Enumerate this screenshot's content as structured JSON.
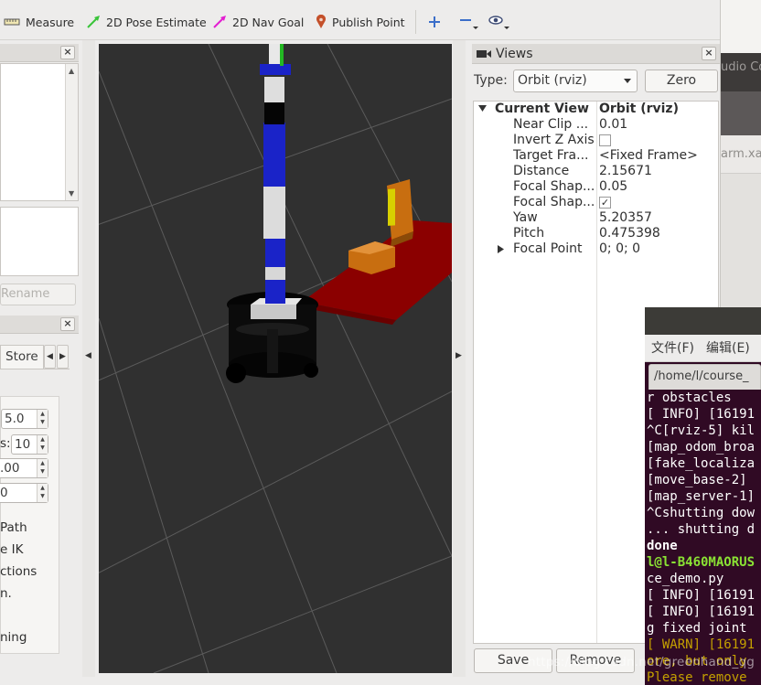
{
  "toolbar": {
    "tools": [
      {
        "id": "measure",
        "label": "Measure",
        "icon": "ruler-icon"
      },
      {
        "id": "pose",
        "label": "2D Pose Estimate",
        "icon": "green-arrow-icon",
        "color": "#3ac43a"
      },
      {
        "id": "nav",
        "label": "2D Nav Goal",
        "icon": "magenta-arrow-icon",
        "color": "#e31fd1"
      },
      {
        "id": "publish",
        "label": "Publish Point",
        "icon": "map-pin-icon",
        "color": "#c4502a"
      }
    ],
    "extra_icons": [
      "plus-icon",
      "minus-icon",
      "eye-icon"
    ]
  },
  "left": {
    "rename_label": "Rename",
    "stored_tab": "Store",
    "fields": [
      {
        "label": "",
        "value": "5.0"
      },
      {
        "label": "s:",
        "value": "10"
      },
      {
        "label": "",
        "value": ".00"
      },
      {
        "label": "",
        "value": "0"
      }
    ],
    "checks": [
      "Path",
      "e IK",
      "ctions",
      "n.",
      "",
      "ning"
    ]
  },
  "views": {
    "title": "Views",
    "type_label": "Type:",
    "type_value": "Orbit (rviz)",
    "zero_label": "Zero",
    "header": {
      "key": "Current View",
      "value": "Orbit (rviz)"
    },
    "props": [
      {
        "key": "Near Clip ...",
        "value": "0.01"
      },
      {
        "key": "Invert Z Axis",
        "value": "",
        "check": "unchecked"
      },
      {
        "key": "Target Fra...",
        "value": "<Fixed Frame>"
      },
      {
        "key": "Distance",
        "value": "2.15671"
      },
      {
        "key": "Focal Shap...",
        "value": "0.05"
      },
      {
        "key": "Focal Shap...",
        "value": "",
        "check": "checked"
      },
      {
        "key": "Yaw",
        "value": "5.20357"
      },
      {
        "key": "Pitch",
        "value": "0.475398"
      },
      {
        "key": "Focal Point",
        "value": "0; 0; 0",
        "expandable": true
      }
    ],
    "save_label": "Save",
    "remove_label": "Remove"
  },
  "bgapp": {
    "title_fragment": "udio Co",
    "tab_fragment": "arm.xac"
  },
  "terminal": {
    "menu": [
      "文件(F)",
      "编辑(E)"
    ],
    "tab": "/home/l/course_",
    "lines": [
      {
        "t": "r obstacles",
        "c": ""
      },
      {
        "t": "[ INFO] [16191",
        "c": ""
      },
      {
        "t": "^C[rviz-5] kil",
        "c": ""
      },
      {
        "t": "[map_odom_broa",
        "c": ""
      },
      {
        "t": "[fake_localiza",
        "c": ""
      },
      {
        "t": "[move_base-2]",
        "c": ""
      },
      {
        "t": "[map_server-1]",
        "c": ""
      },
      {
        "t": "^Cshutting dow",
        "c": ""
      },
      {
        "t": "... shutting d",
        "c": ""
      },
      {
        "t": "done",
        "c": "bold"
      },
      {
        "t": "l@l-B460MAORUS",
        "c": "green"
      },
      {
        "t": "ce_demo.py",
        "c": ""
      },
      {
        "t": "[ INFO] [16191",
        "c": ""
      },
      {
        "t": "[ INFO] [16191",
        "c": ""
      },
      {
        "t": "g fixed joint",
        "c": ""
      },
      {
        "t": "[ WARN] [16191",
        "c": "warn"
      },
      {
        "t": "ore, but only",
        "c": "warn"
      },
      {
        "t": "Please remove",
        "c": "warn"
      }
    ]
  },
  "watermark": "https://blog.csdn.net/greenhand_qg"
}
